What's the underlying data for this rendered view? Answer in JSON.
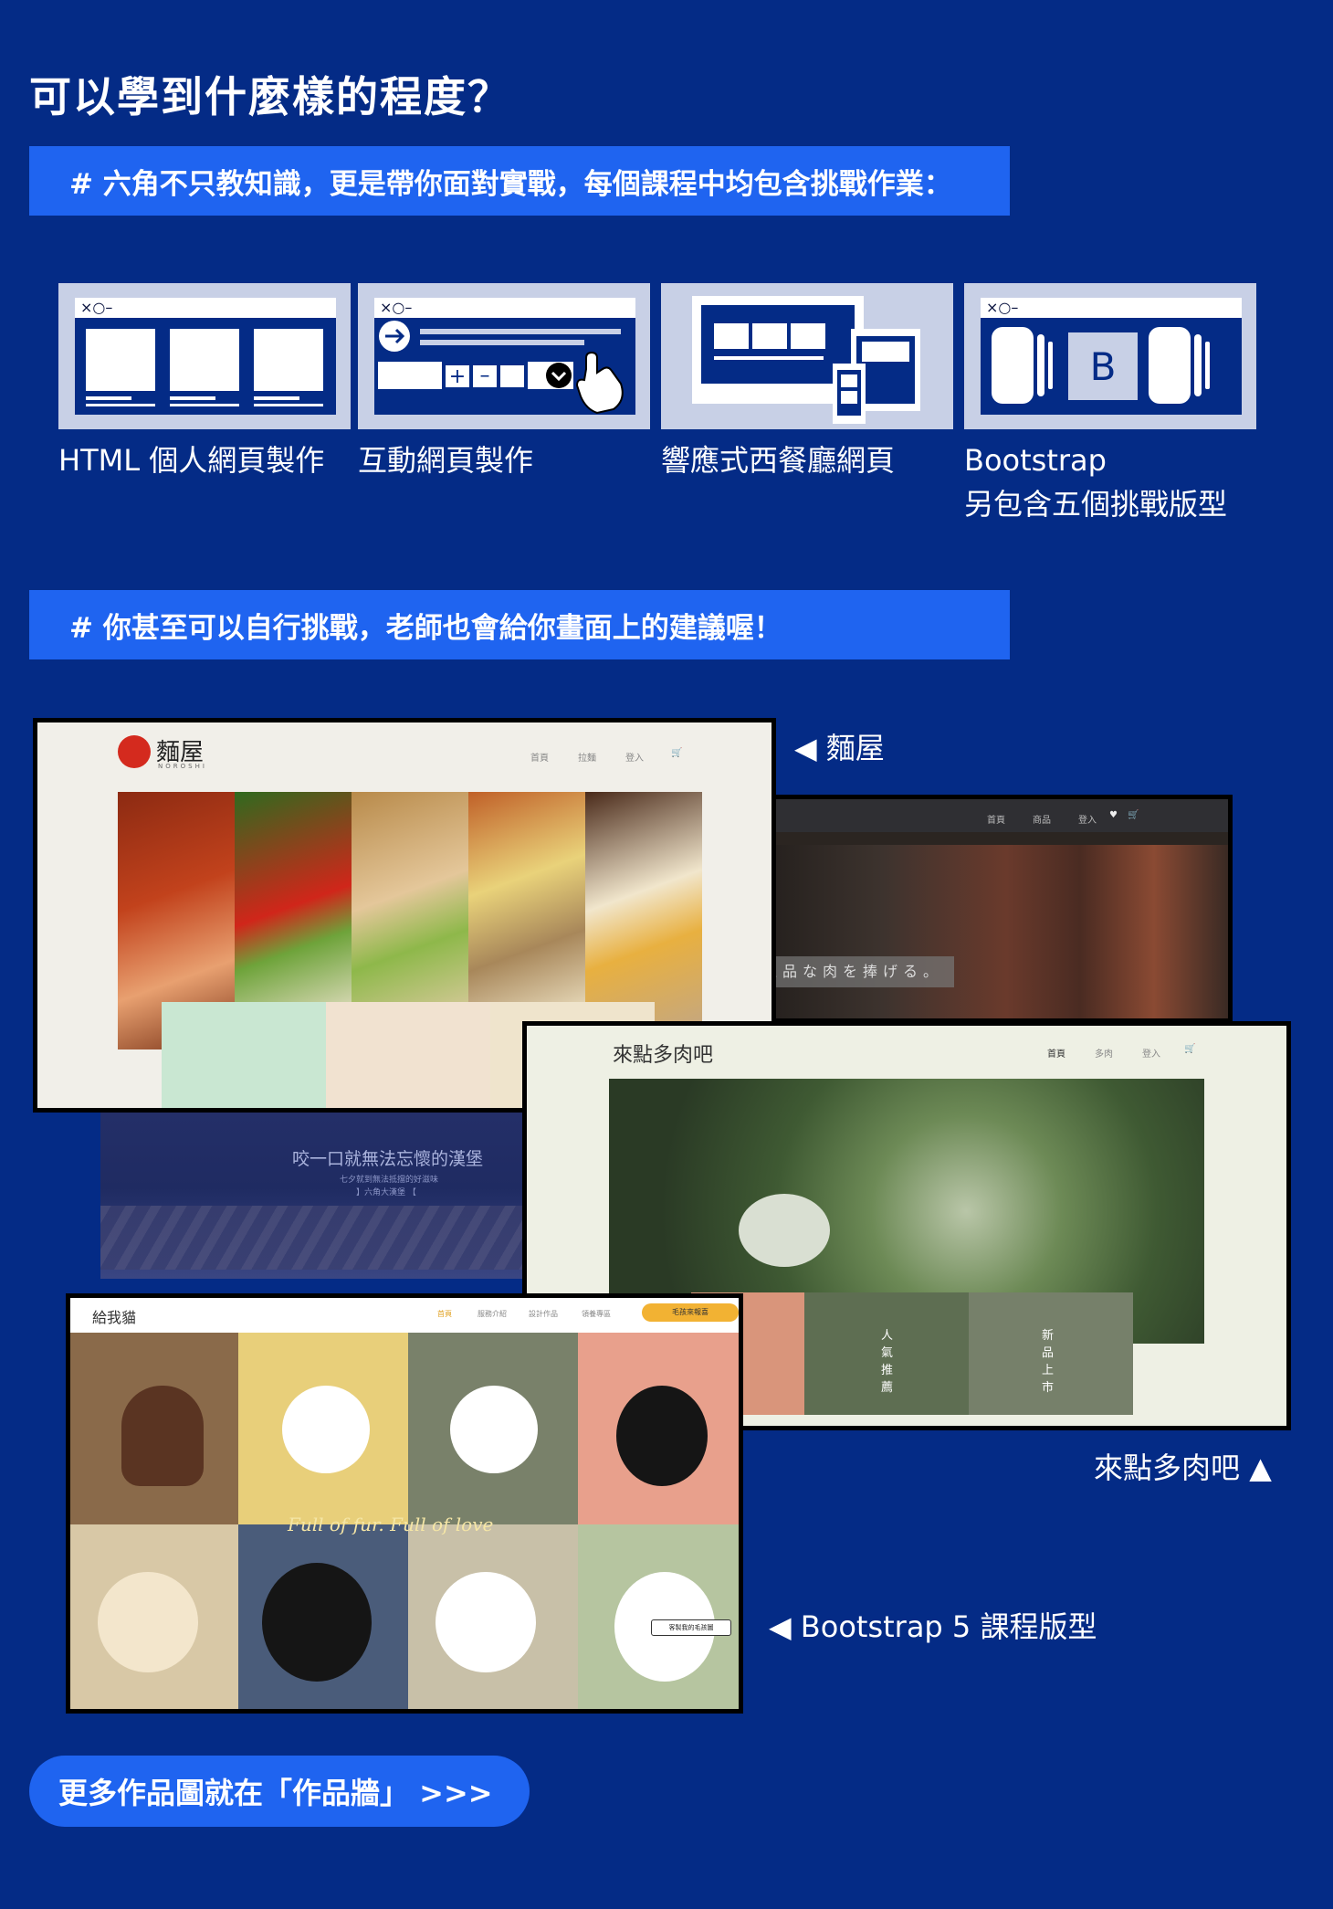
{
  "title": "可以學到什麼樣的程度？",
  "banner1": "# 六角不只教知識，更是帶你面對實戰，每個課程中均包含挑戰作業：",
  "banner2": "# 你甚至可以自行挑戰，老師也會給你畫面上的建議喔！",
  "cards": [
    {
      "label": "HTML 個人網頁製作",
      "icon": "webpage-layout-icon"
    },
    {
      "label": "互動網頁製作",
      "icon": "interactive-ui-icon"
    },
    {
      "label": "響應式西餐廳網頁",
      "icon": "responsive-devices-icon"
    },
    {
      "label": "Bootstrap\n另包含五個挑戰版型",
      "icon": "bootstrap-carousel-icon"
    }
  ],
  "window_controls": "×○–",
  "bootstrap_letter": "B",
  "screens": {
    "ramen": {
      "logo": "麵屋",
      "logo_sub": "NOROSHI",
      "nav": [
        "首頁",
        "拉麵",
        "登入"
      ],
      "caption": "麵屋"
    },
    "meat": {
      "nav": [
        "首頁",
        "商品",
        "登入"
      ],
      "hero_text": "番上品な肉を捧げる。"
    },
    "burger": {
      "hero_title": "咬一口就無法忘懷的漢堡",
      "hero_sub1": "七夕就到無法抵擋的好滋味",
      "hero_sub2": "】六角大漢堡 【"
    },
    "succulent": {
      "logo": "來點多肉吧",
      "nav": [
        "首頁",
        "多肉",
        "登入"
      ],
      "tiles": [
        "人氣推薦",
        "新品上市"
      ],
      "caption": "來點多肉吧"
    },
    "pets": {
      "logo": "給我貓",
      "nav": [
        "首頁",
        "服務介紹",
        "設計作品",
        "領養專區"
      ],
      "nav_button": "毛孩來報喜",
      "tagline": "Full of fur. Full of love",
      "tag": "客製我的毛孩圖",
      "caption": "Bootstrap 5 課程版型"
    }
  },
  "cta": "更多作品圖就在「作品牆」 >>>",
  "colors": {
    "background": "#042b86",
    "banner": "#1f64f0",
    "card": "#c8d0e6"
  }
}
